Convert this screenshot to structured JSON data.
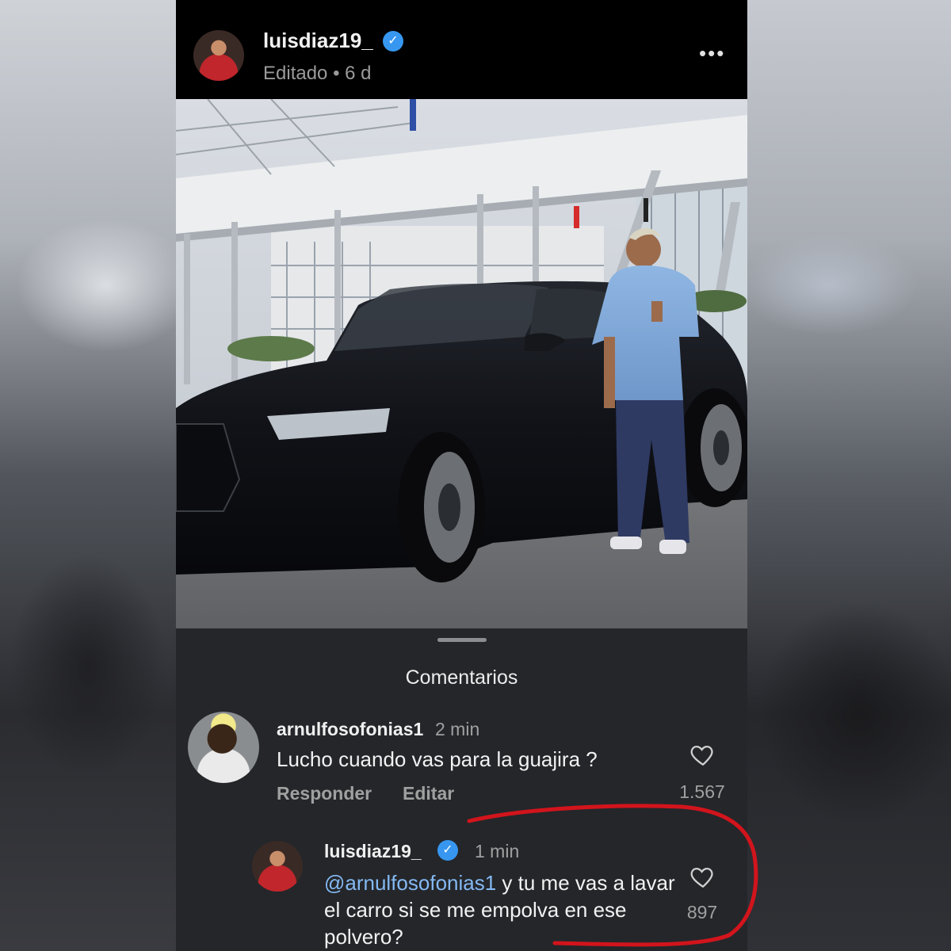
{
  "post": {
    "username": "luisdiaz19_",
    "meta": "Editado • 6 d",
    "more_icon": "more-horizontal-icon"
  },
  "comments_sheet": {
    "title": "Comentarios",
    "comments": [
      {
        "username": "arnulfosofonias1",
        "time": "2 min",
        "text": "Lucho cuando vas para la guajira ?",
        "reply_label": "Responder",
        "edit_label": "Editar",
        "likes": "1.567"
      },
      {
        "username": "luisdiaz19_",
        "time": "1 min",
        "mention": "@arnulfosofonias1",
        "text_line1": " y tu me vas a lavar",
        "text_line2": "el carro si se me empolva en ese",
        "text_line3": "polvero?",
        "likes": "897"
      }
    ]
  },
  "colors": {
    "verified": "#3797f0",
    "mention": "#84b9f3",
    "annotation": "#d2141c",
    "sheet_bg": "#24262a"
  }
}
